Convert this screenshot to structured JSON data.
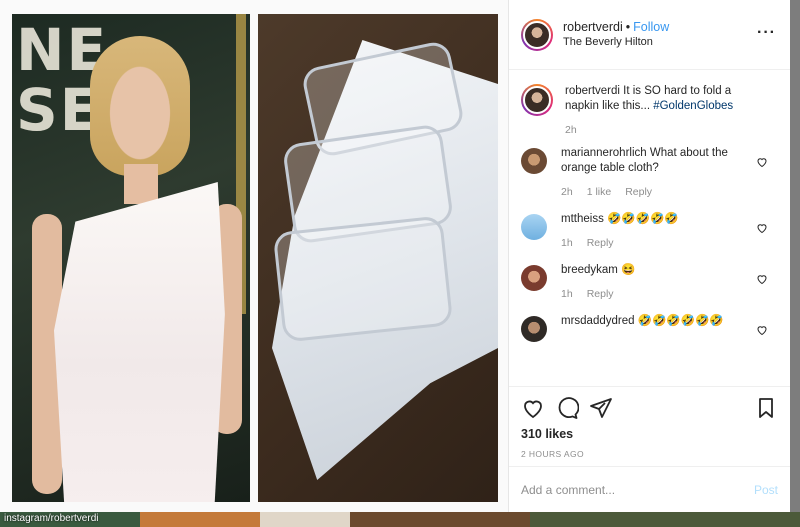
{
  "post": {
    "username": "robertverdi",
    "follow_label": "Follow",
    "location": "The Beverly Hilton",
    "caption_user": "robertverdi",
    "caption_text": "It is SO hard to fold a napkin like this...",
    "caption_hashtag": "#GoldenGlobes",
    "caption_time": "2h"
  },
  "comments": [
    {
      "user": "mariannerohrlich",
      "text": "What about the orange table cloth?",
      "time": "2h",
      "likes": "1 like",
      "reply": "Reply"
    },
    {
      "user": "mttheiss",
      "text": "🤣🤣🤣🤣🤣",
      "time": "1h",
      "reply": "Reply"
    },
    {
      "user": "breedykam",
      "text": "😆",
      "time": "1h",
      "reply": "Reply"
    },
    {
      "user": "mrsdaddydred",
      "text": "🤣🤣🤣🤣🤣🤣"
    }
  ],
  "actions": {
    "likes": "310 likes",
    "time_ago": "2 HOURS AGO",
    "comment_placeholder": "Add a comment...",
    "post_label": "Post"
  },
  "credit": "instagram/robertverdi",
  "photo_backdrop_text": "NE\nSES",
  "colors": {
    "link_blue": "#3897f0",
    "hashtag_blue": "#00376b",
    "muted": "#8e8e8e",
    "text": "#262626"
  }
}
